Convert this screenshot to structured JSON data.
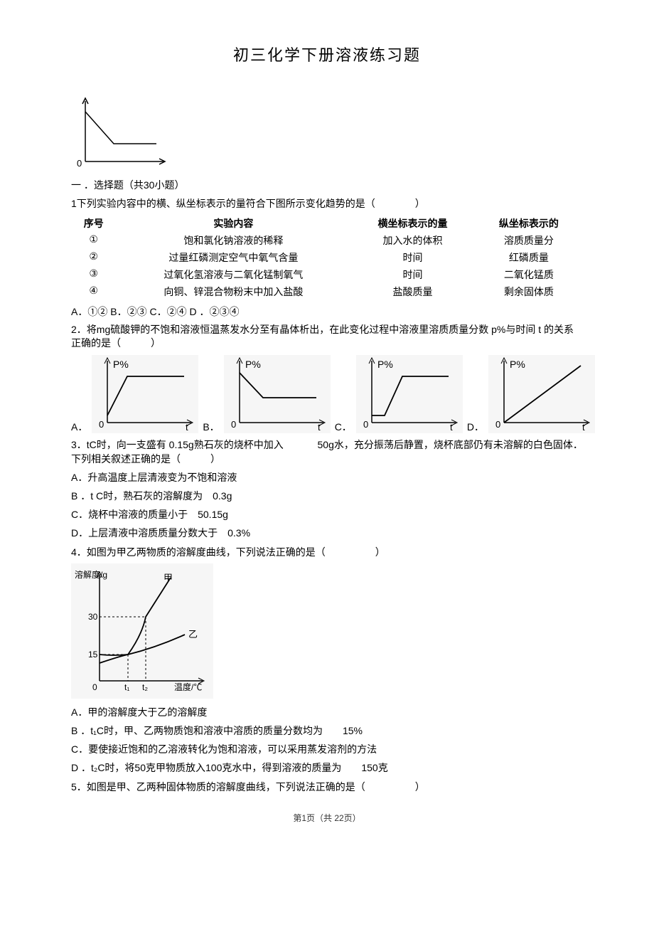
{
  "title": "初三化学下册溶液练习题",
  "section_heading": "一 ．选择题（共30小题）",
  "q1": {
    "stem": "1下列实验内容中的横、纵坐标表示的量符合下图所示变化趋势的是（　　　　）",
    "headers": [
      "序号",
      "实验内容",
      "横坐标表示的量",
      "纵坐标表示的"
    ],
    "rows": [
      [
        "①",
        "饱和氯化钠溶液的稀释",
        "加入水的体积",
        "溶质质量分"
      ],
      [
        "②",
        "过量红磷测定空气中氧气含量",
        "时间",
        "红磷质量"
      ],
      [
        "③",
        "过氧化氢溶液与二氧化锰制氧气",
        "时间",
        "二氧化锰质"
      ],
      [
        "④",
        "向铜、锌混合物粉末中加入盐酸",
        "盐酸质量",
        "剩余固体质"
      ]
    ],
    "options_line": "A．①② B．②③ C．②④ D ．②③④"
  },
  "q2": {
    "stem": "2．将mg硫酸钾的不饱和溶液恒温蒸发水分至有晶体析出，在此变化过程中溶液里溶质质量分数 p%与时间 t 的关系正确的是（　　　）",
    "labels": {
      "A": "A．",
      "B": "B．",
      "C": "C．",
      "D": "D．",
      "y": "P%",
      "x": "t"
    }
  },
  "q3": {
    "stem_part1": "3．tC时，向一支盛有 0.15g熟石灰的烧杯中加入",
    "stem_part2": "50g水，充分振荡后静置，烧杯底部仍有未溶解的白色固体．下列相关叙述正确的是（　　　）",
    "A": "A．升高温度上层清液变为不饱和溶液",
    "B": "B ．t C时，熟石灰的溶解度为　0.3g",
    "C": "C．烧杯中溶液的质量小于　50.15g",
    "D": "D．上层清液中溶质质量分数大于　0.3%"
  },
  "q4": {
    "stem": "4．如图为甲乙两物质的溶解度曲线，下列说法正确的是（　　　　　）",
    "A": "A．甲的溶解度大于乙的溶解度",
    "B": "B ．t₁C时，甲、乙两物质饱和溶液中溶质的质量分数均为　　15%",
    "C": "C．要使接近饱和的乙溶液转化为饱和溶液，可以采用蒸发溶剂的方法",
    "D": "D ．t₂C时，将50克甲物质放入100克水中，得到溶液的质量为　　150克",
    "axis_y": "溶解度/g",
    "axis_x": "温度/℃",
    "ticks_y": [
      "30",
      "15"
    ],
    "ticks_x": [
      "t₁",
      "t₂"
    ],
    "series": [
      "甲",
      "乙"
    ],
    "origin": "0"
  },
  "q5": {
    "stem": "5．如图是甲、乙两种固体物质的溶解度曲线，下列说法正确的是（　　　　　）"
  },
  "footer": "第1页（共 22页）",
  "chart_data": [
    {
      "type": "line",
      "role": "q1-figure",
      "description": "y decreases then becomes flat",
      "x": [
        0,
        1,
        3
      ],
      "y": [
        2,
        1,
        1
      ],
      "xlabel": "",
      "ylabel": "",
      "origin": "0"
    },
    {
      "type": "line",
      "role": "q2-option-A",
      "x": [
        0,
        1,
        3
      ],
      "y": [
        0.3,
        2,
        2
      ],
      "xlabel": "t",
      "ylabel": "P%",
      "origin": "0"
    },
    {
      "type": "line",
      "role": "q2-option-B",
      "x": [
        0,
        1,
        3
      ],
      "y": [
        2,
        1,
        1
      ],
      "xlabel": "t",
      "ylabel": "P%",
      "origin": "0"
    },
    {
      "type": "line",
      "role": "q2-option-C",
      "x": [
        0,
        0.5,
        1,
        3
      ],
      "y": [
        0.3,
        0.3,
        2,
        2
      ],
      "xlabel": "t",
      "ylabel": "P%",
      "origin": "0"
    },
    {
      "type": "line",
      "role": "q2-option-D",
      "x": [
        0,
        3
      ],
      "y": [
        0,
        2.5
      ],
      "xlabel": "t",
      "ylabel": "P%",
      "origin": "0"
    },
    {
      "type": "line",
      "role": "q4-solubility",
      "xlabel": "温度/℃",
      "ylabel": "溶解度/g",
      "series": [
        {
          "name": "甲",
          "x": [
            0,
            1,
            1.3,
            2.5
          ],
          "y": [
            12,
            15,
            18,
            45
          ]
        },
        {
          "name": "乙",
          "x": [
            0,
            1,
            2.5
          ],
          "y": [
            15,
            15,
            22
          ]
        }
      ],
      "y_ticks": [
        15,
        30
      ],
      "x_ticks": [
        "t₁",
        "t₂"
      ],
      "origin": "0"
    }
  ]
}
